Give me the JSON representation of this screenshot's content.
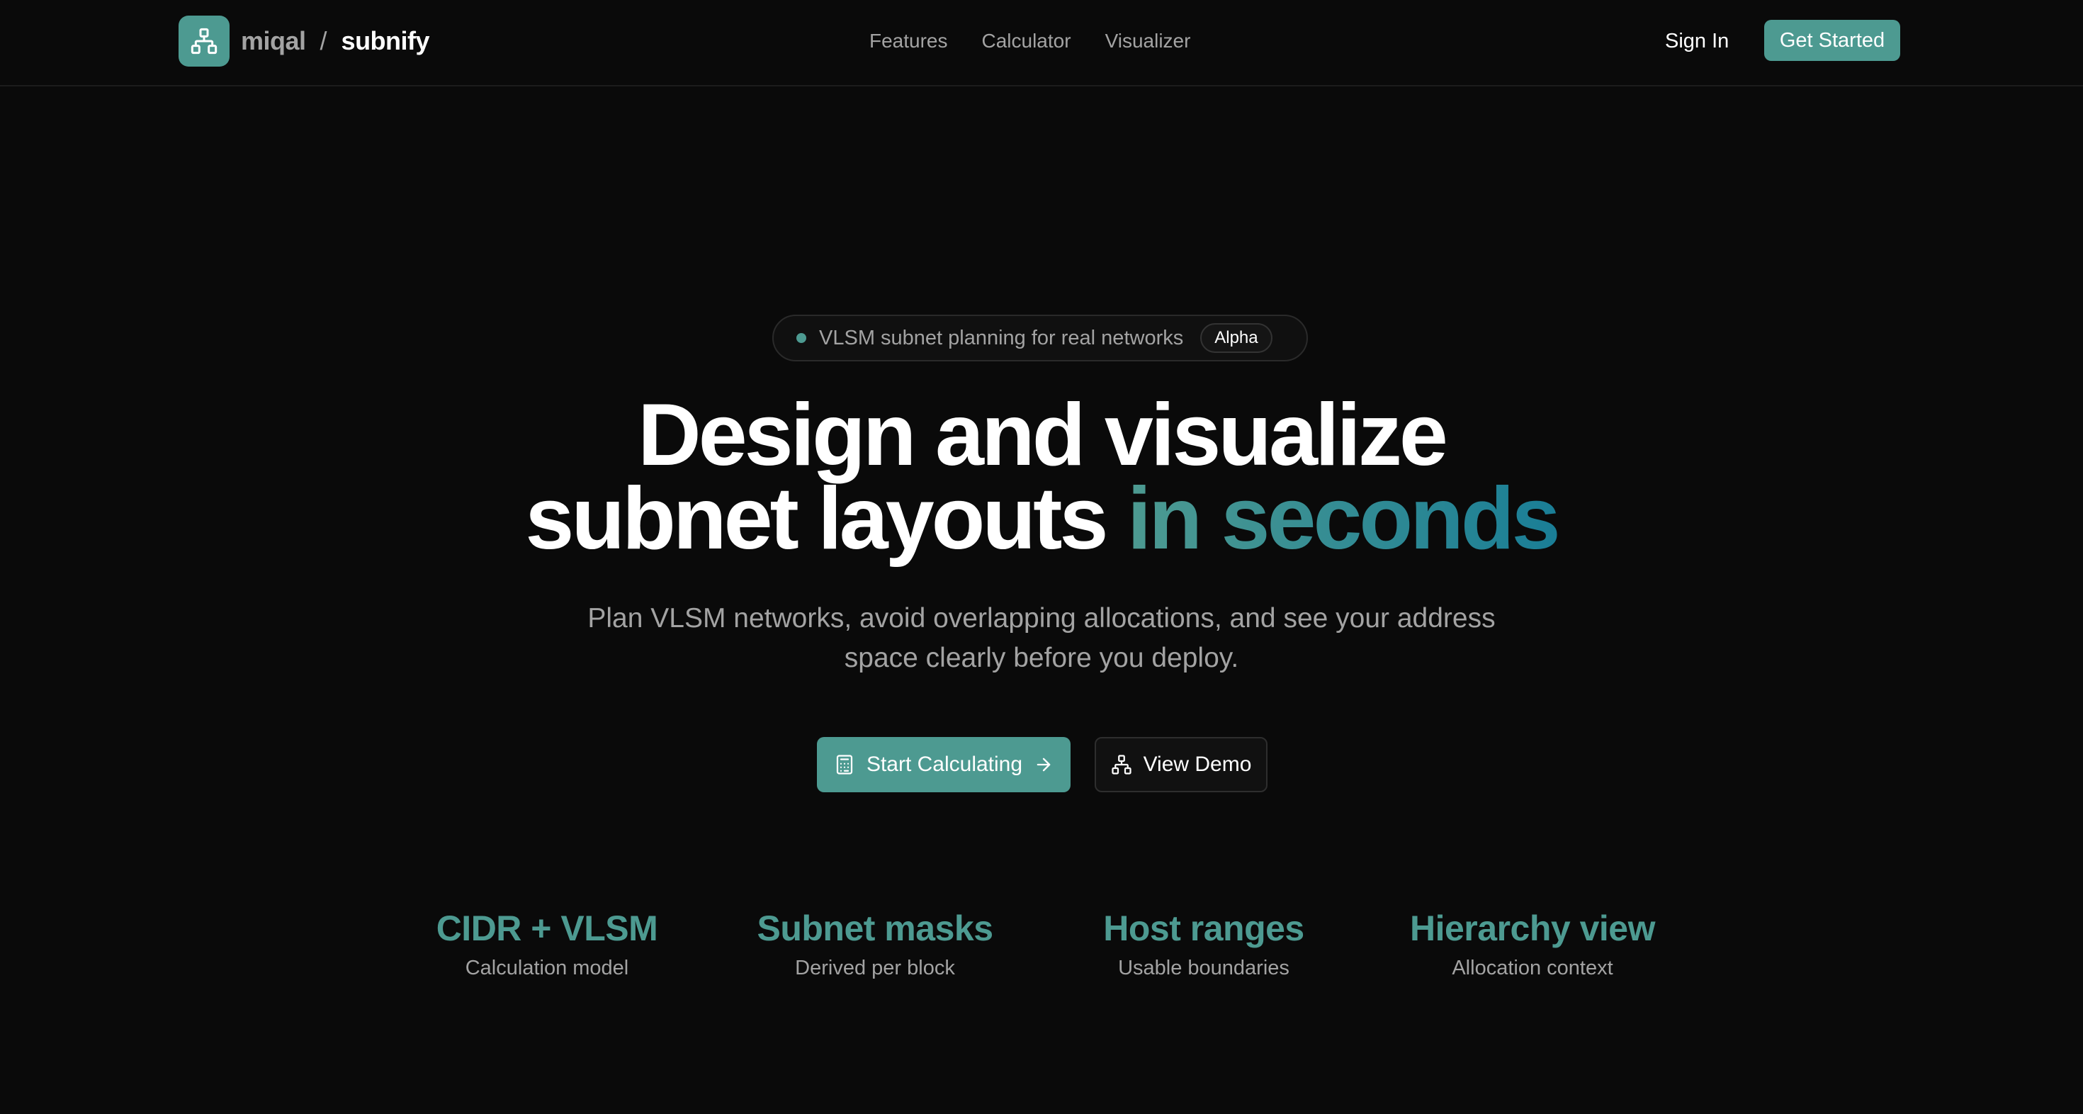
{
  "brand": {
    "org": "miqal",
    "separator": "/",
    "product": "subnify",
    "logo_icon": "network-icon"
  },
  "nav": {
    "items": [
      {
        "label": "Features"
      },
      {
        "label": "Calculator"
      },
      {
        "label": "Visualizer"
      }
    ],
    "sign_in": "Sign In",
    "get_started": "Get Started"
  },
  "hero": {
    "pill_text": "VLSM subnet planning for real networks",
    "pill_badge": "Alpha",
    "headline_line1": "Design and visualize",
    "headline_line2_plain": "subnet layouts",
    "headline_line2_accent": "in seconds",
    "subtitle": "Plan VLSM networks, avoid overlapping allocations, and see your address space clearly before you deploy.",
    "primary_cta": "Start Calculating",
    "secondary_cta": "View Demo"
  },
  "stats": [
    {
      "value": "CIDR + VLSM",
      "label": "Calculation model"
    },
    {
      "value": "Subnet masks",
      "label": "Derived per block"
    },
    {
      "value": "Host ranges",
      "label": "Usable boundaries"
    },
    {
      "value": "Hierarchy view",
      "label": "Allocation context"
    }
  ],
  "colors": {
    "background": "#0a0a0a",
    "accent": "#4d9a91",
    "accent_gradient_end": "#1a7e96",
    "muted_text": "#a3a3a3"
  }
}
